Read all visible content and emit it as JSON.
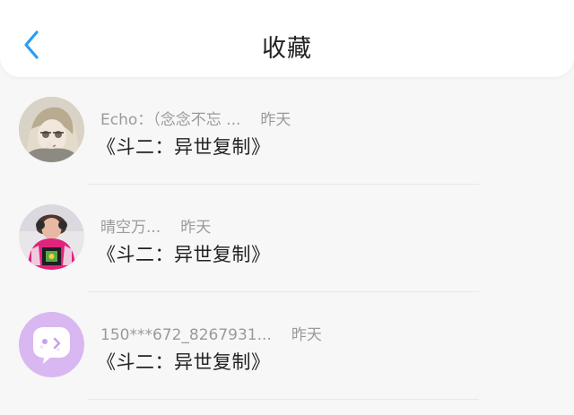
{
  "header": {
    "title": "收藏",
    "back_icon": "chevron-left-icon",
    "accent_color": "#2b9df4"
  },
  "items": [
    {
      "name": "Echo：（念念不忘 ...",
      "time": "昨天",
      "content": "《斗二：异世复制》"
    },
    {
      "name": "晴空万...",
      "time": "昨天",
      "content": "《斗二：异世复制》"
    },
    {
      "name": "150***672_8267931...",
      "time": "昨天",
      "content": "《斗二：异世复制》"
    }
  ]
}
